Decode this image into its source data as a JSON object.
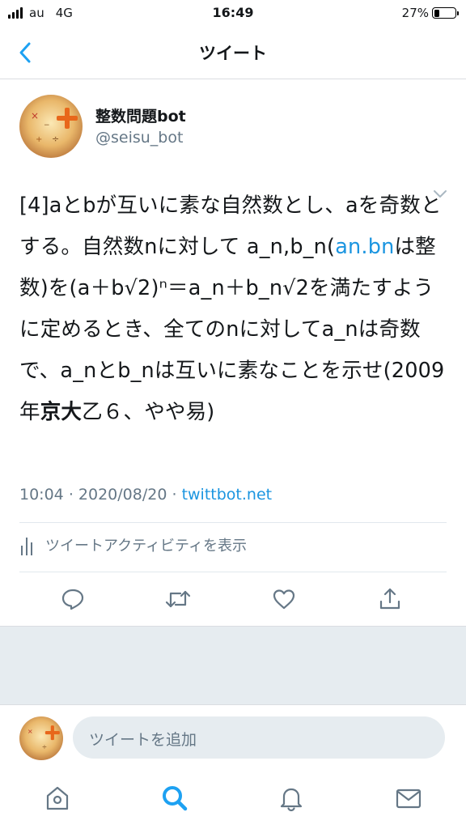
{
  "status_bar": {
    "carrier": "au",
    "network": "4G",
    "time": "16:49",
    "battery_percent": "27%",
    "battery_level": 0.27
  },
  "nav": {
    "title": "ツイート"
  },
  "tweet": {
    "author_name": "整数問題bot",
    "author_handle": "@seisu_bot",
    "text_parts": {
      "p1": "[4]aとbが互いに素な自然数とし、aを奇数とする。自然数nに対して a_n,b_n(",
      "link": "an.bn",
      "p2": "は整数)を(a＋b√2)ⁿ＝a_n＋b_n√2を満たすように定めるとき、全てのnに対してa_nは奇数で、a_nとb_nは互いに素なことを示せ(2009年",
      "bold": "京大",
      "p3": "乙６、やや易)"
    },
    "time": "10:04",
    "date": "2020/08/20",
    "source": "twittbot.net",
    "activity_label": "ツイートアクティビティを表示"
  },
  "compose": {
    "placeholder": "ツイートを追加"
  },
  "colors": {
    "link": "#1b95e0",
    "secondary_text": "#657786",
    "icon": "#657786",
    "active_tab": "#1da1f2",
    "gray_bg": "#e6ecf0"
  },
  "icons": {
    "back": "chevron-left-icon",
    "caret": "chevron-down-icon",
    "reply": "reply-icon",
    "retweet": "retweet-icon",
    "like": "heart-icon",
    "share": "share-icon",
    "activity": "bar-chart-icon",
    "tabs": [
      "home-icon",
      "search-icon",
      "notifications-icon",
      "messages-icon"
    ]
  }
}
